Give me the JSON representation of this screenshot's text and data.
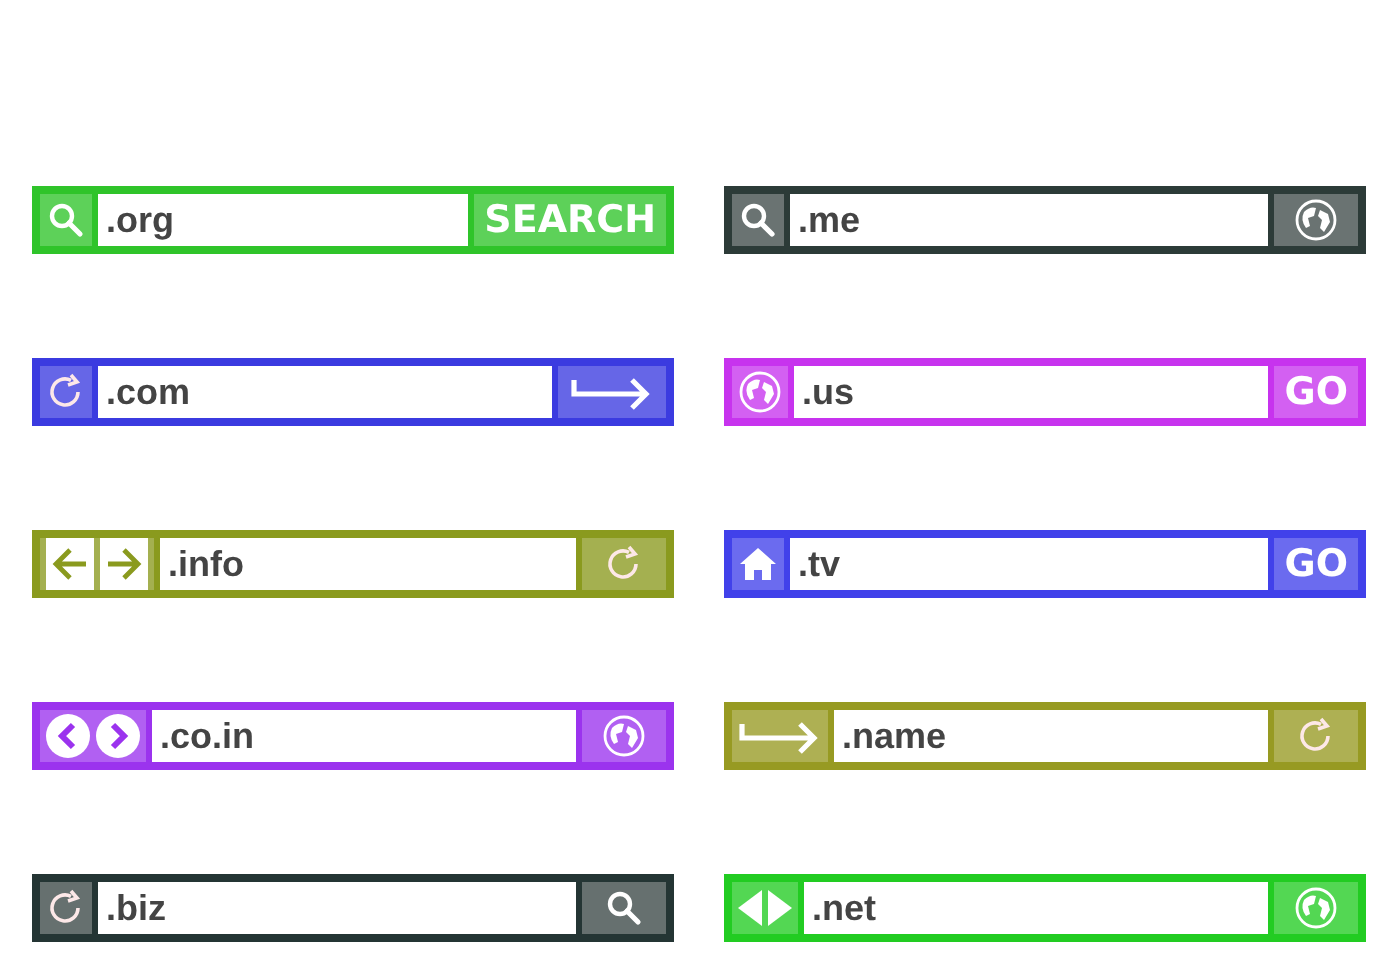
{
  "bars": [
    {
      "color": "#2fc42a",
      "left": [
        {
          "kind": "search"
        }
      ],
      "value": ".org",
      "right": {
        "kind": "text",
        "label": "SEARCH"
      }
    },
    {
      "color": "#2c3b38",
      "left": [
        {
          "kind": "search"
        }
      ],
      "value": ".me",
      "right": {
        "kind": "globe"
      }
    },
    {
      "color": "#3b3be0",
      "left": [
        {
          "kind": "refresh"
        }
      ],
      "value": ".com",
      "right": {
        "kind": "hook-arrow"
      }
    },
    {
      "color": "#c733ee",
      "left": [
        {
          "kind": "globe"
        }
      ],
      "value": ".us",
      "right": {
        "kind": "text",
        "label": "GO"
      }
    },
    {
      "color": "#8a9a1e",
      "left": [
        {
          "kind": "back-boxed"
        },
        {
          "kind": "forward-boxed"
        }
      ],
      "value": ".info",
      "right": {
        "kind": "refresh"
      }
    },
    {
      "color": "#4141ea",
      "left": [
        {
          "kind": "home"
        }
      ],
      "value": ".tv",
      "right": {
        "kind": "text",
        "label": "GO"
      }
    },
    {
      "color": "#9b33ee",
      "left": [
        {
          "kind": "chevron-left"
        },
        {
          "kind": "chevron-right"
        }
      ],
      "value": ".co.in",
      "right": {
        "kind": "globe"
      }
    },
    {
      "color": "#979a22",
      "left": [
        {
          "kind": "hook-arrow"
        }
      ],
      "value": ".name",
      "right": {
        "kind": "refresh"
      }
    },
    {
      "color": "#243534",
      "left": [
        {
          "kind": "refresh"
        }
      ],
      "value": ".biz",
      "right": {
        "kind": "search"
      }
    },
    {
      "color": "#22cc22",
      "left": [
        {
          "kind": "triangle-left"
        },
        {
          "kind": "triangle-right"
        }
      ],
      "value": ".net",
      "right": {
        "kind": "globe"
      }
    }
  ]
}
